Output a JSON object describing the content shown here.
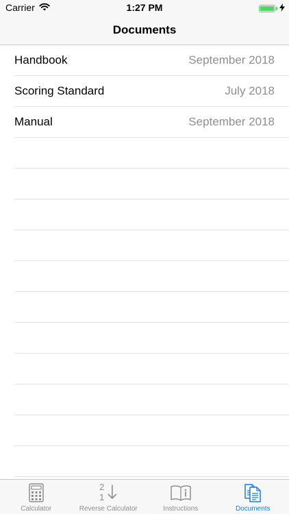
{
  "status_bar": {
    "carrier": "Carrier",
    "time": "1:27 PM",
    "battery_level": 1.0
  },
  "nav": {
    "title": "Documents"
  },
  "documents": [
    {
      "title": "Handbook",
      "date": "September 2018"
    },
    {
      "title": "Scoring Standard",
      "date": "July 2018"
    },
    {
      "title": "Manual",
      "date": "September 2018"
    }
  ],
  "tabs": [
    {
      "label": "Calculator",
      "icon": "calculator-icon",
      "active": false
    },
    {
      "label": "Reverse Calculator",
      "icon": "reverse-sort-icon",
      "active": false,
      "icon_digits": [
        "2",
        "1"
      ]
    },
    {
      "label": "Instructions",
      "icon": "book-info-icon",
      "active": false
    },
    {
      "label": "Documents",
      "icon": "documents-icon",
      "active": true
    }
  ],
  "colors": {
    "accent": "#1a7ed6",
    "inactive": "#8e8e93",
    "battery": "#4cd964",
    "secondary_text": "#8e8e93"
  }
}
